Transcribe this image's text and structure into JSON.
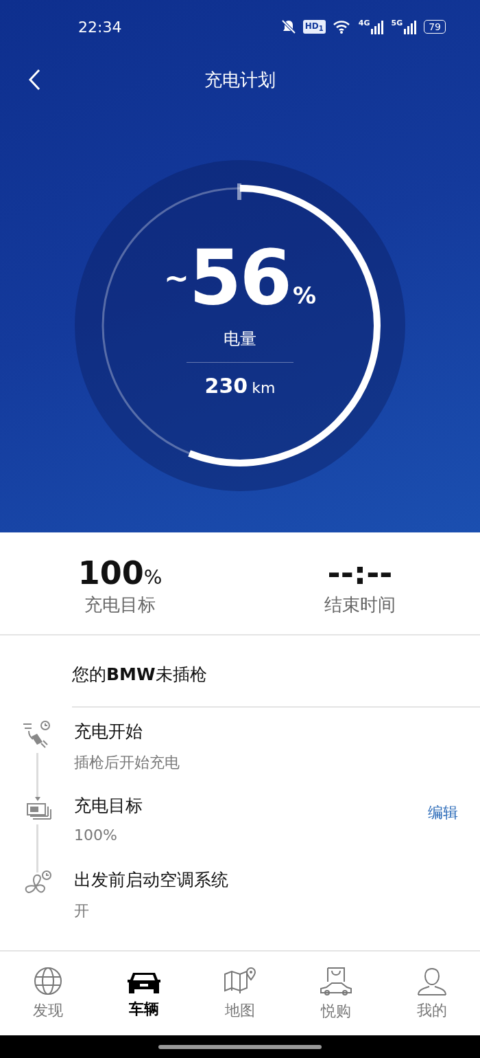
{
  "status_bar": {
    "time": "22:34",
    "hd_label": "HD$_{1}$",
    "network_1": "4G",
    "network_2": "5G",
    "battery": "79"
  },
  "header": {
    "title": "充电计划"
  },
  "gauge": {
    "prefix": "~",
    "value": "56",
    "unit": "%",
    "label": "电量",
    "range": "230",
    "range_unit": "km",
    "level": 0.56
  },
  "stats": [
    {
      "value": "100",
      "unit": "%",
      "label": "充电目标"
    },
    {
      "value": "--:--",
      "label": "结束时间"
    }
  ],
  "plug_status": "您的**BMW**未插枪",
  "steps": [
    {
      "kind": "plug",
      "title": "充电开始",
      "detail": "插枪后开始充电"
    },
    {
      "kind": "battery",
      "title": "充电目标",
      "detail": "100%",
      "action": "编辑"
    },
    {
      "kind": "fan",
      "title": "出发前启动空调系统",
      "detail": "开"
    }
  ],
  "nav": [
    {
      "kind": "globe",
      "label": "发现",
      "selected": false
    },
    {
      "kind": "car",
      "label": "车辆",
      "selected": true
    },
    {
      "kind": "map",
      "label": "地图",
      "selected": false
    },
    {
      "kind": "shop",
      "label": "悦购",
      "selected": false
    },
    {
      "kind": "person",
      "label": "我的",
      "selected": false
    }
  ]
}
